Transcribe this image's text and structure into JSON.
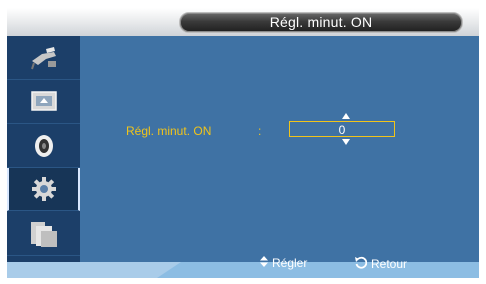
{
  "title": "Régl. minut. ON",
  "sidebar": {
    "items": [
      {
        "icon": "input-plug-icon"
      },
      {
        "icon": "picture-icon"
      },
      {
        "icon": "sound-icon"
      },
      {
        "icon": "setup-gear-icon",
        "active": true
      },
      {
        "icon": "multi-window-icon"
      }
    ]
  },
  "setting": {
    "label": "Régl. minut. ON",
    "colon": ":",
    "value": "0"
  },
  "footer": {
    "adjust_label": "Régler",
    "return_label": "Retour"
  }
}
